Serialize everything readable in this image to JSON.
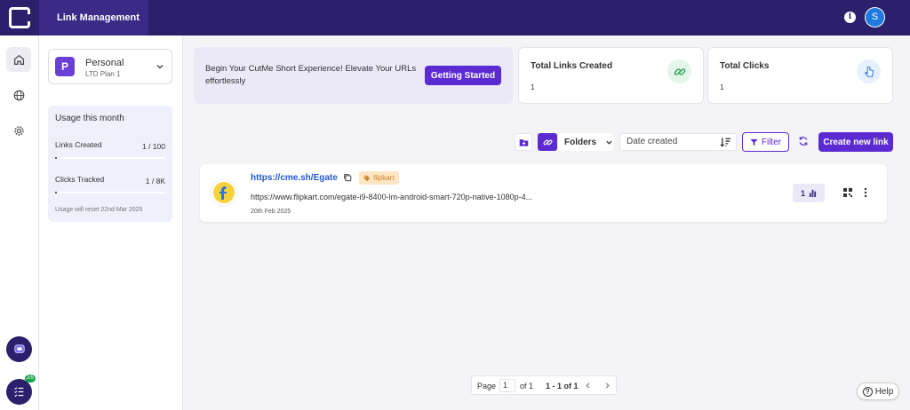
{
  "header": {
    "title": "Link Management",
    "avatar_initial": "S",
    "info_glyph": "i"
  },
  "workspace": {
    "initial": "P",
    "name": "Personal",
    "plan": "LTD Plan 1"
  },
  "usage": {
    "title": "Usage this month",
    "links_label": "Links Created",
    "links_value": "1 / 100",
    "links_fraction": 0.01,
    "clicks_label": "Clicks Tracked",
    "clicks_value": "1 / 8K",
    "clicks_fraction": 0.0001,
    "reset_text": "Usage will reset 22nd Mar 2025"
  },
  "banner": {
    "text": "Begin Your CutMe Short Experience! Elevate Your URLs effortlessly",
    "button": "Getting Started"
  },
  "stats": [
    {
      "title": "Total Links Created",
      "value": "1",
      "icon": "link-icon"
    },
    {
      "title": "Total Clicks",
      "value": "1",
      "icon": "pointer-icon"
    }
  ],
  "toolbar": {
    "folders": "Folders",
    "date_sort": "Date created",
    "filter": "Filter",
    "create": "Create new link"
  },
  "links": [
    {
      "short_url": "https://cme.sh/Egate",
      "tag": "flipkart",
      "long_url": "https://www.flipkart.com/egate-i9-8400-lm-android-smart-720p-native-1080p-4...",
      "date": "20th Feb 2025",
      "clicks": "1",
      "favicon": "flipkart-icon"
    }
  ],
  "pagination": {
    "page_label": "Page",
    "page_value": "1",
    "of_total": "of 1",
    "range": "1 - 1 of 1"
  },
  "help": {
    "label": "Help",
    "glyph": "?"
  },
  "rail": {
    "tasks_badge": "2/5"
  },
  "colors": {
    "brand": "#2c1f6b",
    "accent": "#5b2bd1",
    "link": "#2159d6",
    "tag_bg": "#fde6c4"
  }
}
